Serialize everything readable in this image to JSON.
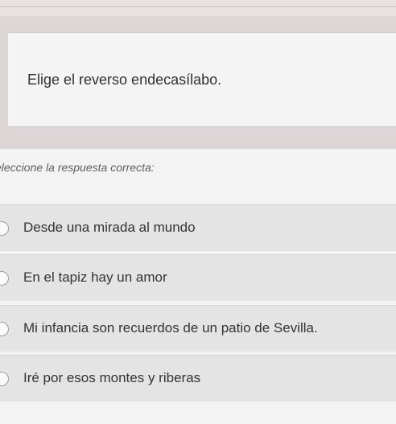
{
  "question": {
    "text": "Elige el reverso endecasílabo."
  },
  "answers": {
    "instruction": "eleccione la respuesta correcta:",
    "options": [
      {
        "label": "Desde una mirada al mundo"
      },
      {
        "label": "En el tapiz hay un amor"
      },
      {
        "label": "Mi infancia son recuerdos de un patio de Sevilla."
      },
      {
        "label": "Iré por esos montes y riberas"
      }
    ]
  }
}
